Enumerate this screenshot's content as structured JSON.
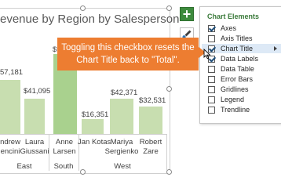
{
  "chart": {
    "title": "evenue by Region by Salesperson",
    "values": [
      "57,181",
      "$41,095",
      "$9",
      "$16,351",
      "$42,371",
      "$32,531"
    ],
    "salespeople": [
      "ndrew\nencini",
      "Laura\nGiussani",
      "Anne\nLarsen",
      "Jan Kotas",
      "Mariya\nSergienko",
      "Robert\nZare"
    ],
    "regions": [
      "East",
      "South",
      "West"
    ]
  },
  "panel": {
    "title": "Chart Elements",
    "options": [
      {
        "label": "Axes",
        "checked": true
      },
      {
        "label": "Axis Titles",
        "checked": false
      },
      {
        "label": "Chart Title",
        "checked": true
      },
      {
        "label": "Data Labels",
        "checked": true
      },
      {
        "label": "Data Table",
        "checked": false
      },
      {
        "label": "Error Bars",
        "checked": false
      },
      {
        "label": "Gridlines",
        "checked": false
      },
      {
        "label": "Legend",
        "checked": false
      },
      {
        "label": "Trendline",
        "checked": false
      }
    ]
  },
  "buttons": {
    "plus_label": "+"
  },
  "callout": {
    "text": "Toggling this checkbox resets the Chart Title back to \"Total\"."
  },
  "colors": {
    "bar": "#c8deb0",
    "callout": "#ed7d31",
    "panel_title": "#3a7a3a",
    "plus_button": "#3d8b3d"
  }
}
